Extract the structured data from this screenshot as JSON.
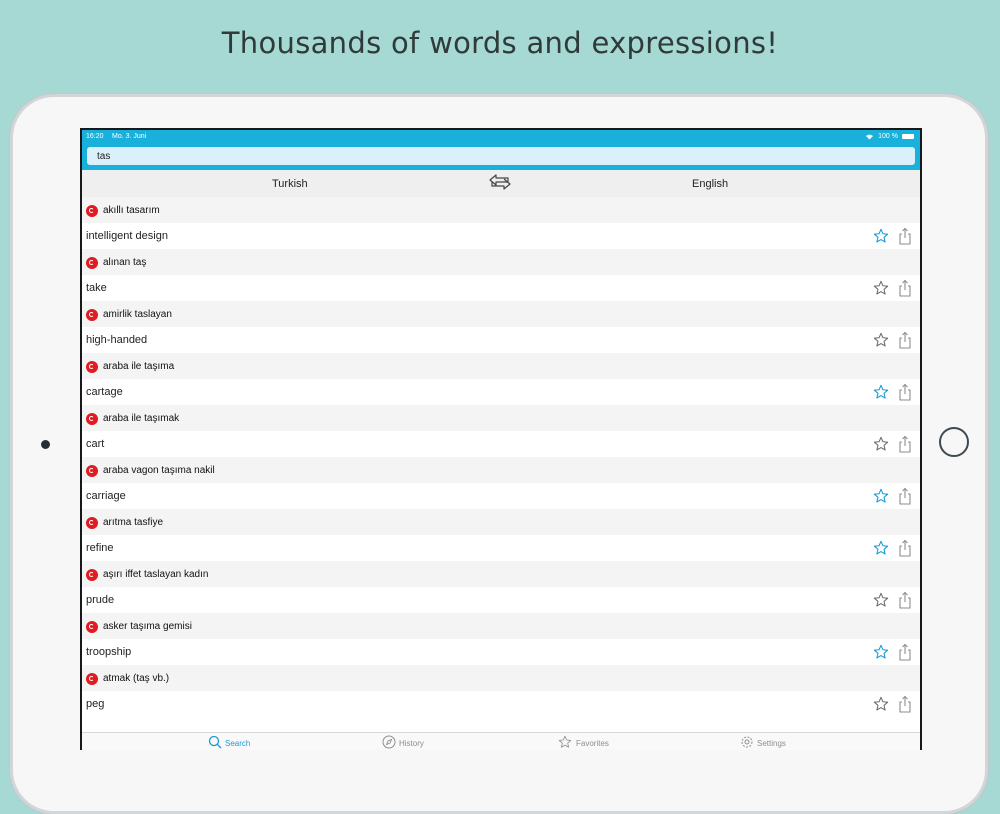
{
  "headline": "Thousands of words and expressions!",
  "status": {
    "time": "16:20",
    "date": "Mo. 3. Juni",
    "battery": "100 %"
  },
  "search": {
    "value": "tas",
    "placeholder": ""
  },
  "languages": {
    "left": "Turkish",
    "right": "English",
    "swap_icon": "swap-arrows-icon"
  },
  "entries": [
    {
      "term": "akıllı tasarım",
      "translation": "intelligent design",
      "favorite": true
    },
    {
      "term": "alınan taş",
      "translation": "take",
      "favorite": false
    },
    {
      "term": "amirlik taslayan",
      "translation": "high-handed",
      "favorite": false
    },
    {
      "term": "araba ile taşıma",
      "translation": "cartage",
      "favorite": true
    },
    {
      "term": "araba ile taşımak",
      "translation": "cart",
      "favorite": false
    },
    {
      "term": "araba vagon taşıma nakil",
      "translation": "carriage",
      "favorite": true
    },
    {
      "term": "arıtma tasfiye",
      "translation": "refine",
      "favorite": true
    },
    {
      "term": "aşırı iffet taslayan kadın",
      "translation": "prude",
      "favorite": false
    },
    {
      "term": "asker taşıma gemisi",
      "translation": "troopship",
      "favorite": true
    },
    {
      "term": "atmak (taş vb.)",
      "translation": "peg",
      "favorite": false
    }
  ],
  "tabs": [
    {
      "label": "Search",
      "icon": "magnifier-icon",
      "active": true
    },
    {
      "label": "History",
      "icon": "compass-icon",
      "active": false
    },
    {
      "label": "Favorites",
      "icon": "star-icon",
      "active": false
    },
    {
      "label": "Settings",
      "icon": "gear-icon",
      "active": false
    }
  ],
  "colors": {
    "background": "#a6d9d4",
    "topbar": "#19b0db",
    "accent": "#1a9bd7",
    "flag": "#e01b22",
    "star_inactive": "#6e6e73"
  }
}
